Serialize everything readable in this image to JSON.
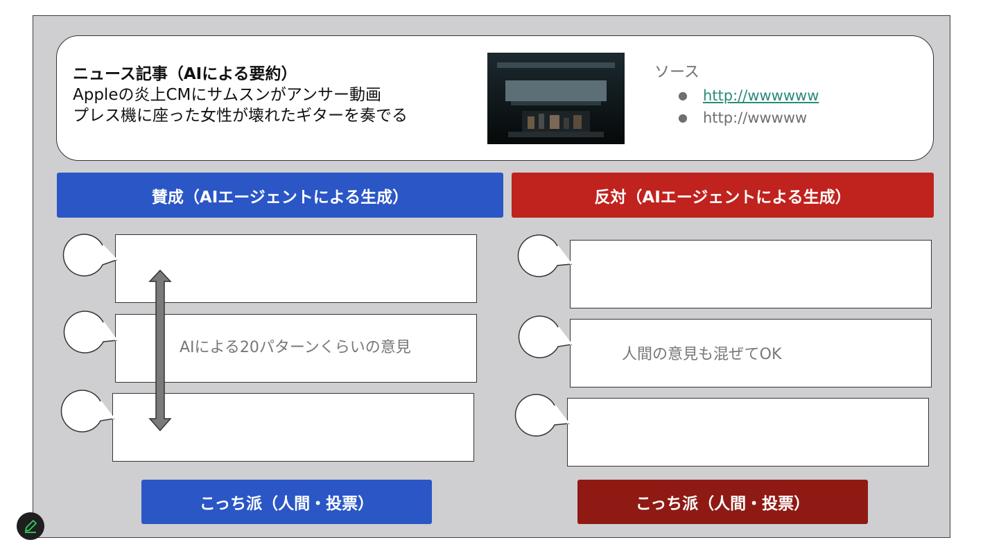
{
  "news": {
    "heading": "ニュース記事（AIによる要約）",
    "headline_line1": "Appleの炎上CMにサムスンがアンサー動画",
    "headline_line2": "プレス機に座った女性が壊れたギターを奏でる"
  },
  "sources": {
    "title": "ソース",
    "items": [
      {
        "bullet": "●",
        "label": "http://wwwwww",
        "is_link": true
      },
      {
        "bullet": "●",
        "label": "http://wwwww",
        "is_link": false
      }
    ]
  },
  "pro": {
    "header": "賛成（AIエージェントによる生成）",
    "placeholder": "AIによる20パターンくらいの意見",
    "vote_label": "こっち派（人間・投票）",
    "color": "#2a56c6"
  },
  "con": {
    "header": "反対（AIエージェントによる生成）",
    "placeholder": "人間の意見も混ぜてOK",
    "vote_label": "こっち派（人間・投票）",
    "color": "#c0221e"
  },
  "icons": {
    "edit": "pencil-icon",
    "scroll_arrow": "double-arrow-icon",
    "speaker": "speech-bubble-icon"
  }
}
